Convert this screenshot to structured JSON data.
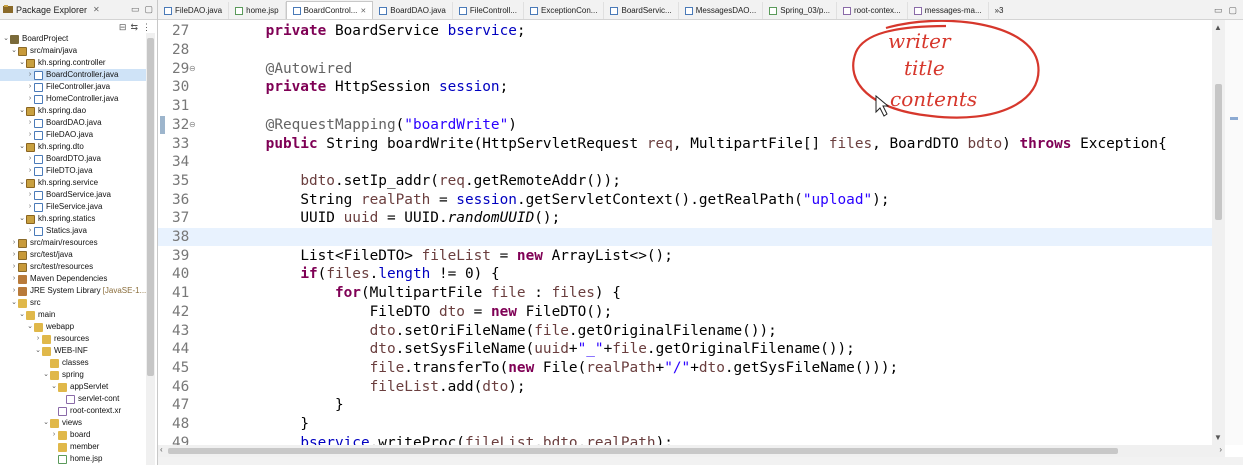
{
  "package_explorer": {
    "title": "Package Explorer",
    "tree": [
      {
        "label": "BoardProject",
        "depth": 0,
        "icon": "project-icon",
        "tw": "v"
      },
      {
        "label": "src/main/java",
        "depth": 1,
        "icon": "source-folder-icon",
        "tw": "v"
      },
      {
        "label": "kh.spring.controller",
        "depth": 2,
        "icon": "package-icon",
        "tw": "v"
      },
      {
        "label": "BoardController.java",
        "depth": 3,
        "icon": "java-file-icon",
        "tw": ">",
        "selected": true
      },
      {
        "label": "FileController.java",
        "depth": 3,
        "icon": "java-file-icon",
        "tw": ">"
      },
      {
        "label": "HomeController.java",
        "depth": 3,
        "icon": "java-file-icon",
        "tw": ">"
      },
      {
        "label": "kh.spring.dao",
        "depth": 2,
        "icon": "package-icon",
        "tw": "v"
      },
      {
        "label": "BoardDAO.java",
        "depth": 3,
        "icon": "java-file-icon",
        "tw": ">"
      },
      {
        "label": "FileDAO.java",
        "depth": 3,
        "icon": "java-file-icon",
        "tw": ">"
      },
      {
        "label": "kh.spring.dto",
        "depth": 2,
        "icon": "package-icon",
        "tw": "v"
      },
      {
        "label": "BoardDTO.java",
        "depth": 3,
        "icon": "java-file-icon",
        "tw": ">"
      },
      {
        "label": "FileDTO.java",
        "depth": 3,
        "icon": "java-file-icon",
        "tw": ">"
      },
      {
        "label": "kh.spring.service",
        "depth": 2,
        "icon": "package-icon",
        "tw": "v"
      },
      {
        "label": "BoardService.java",
        "depth": 3,
        "icon": "java-file-icon",
        "tw": ">"
      },
      {
        "label": "FileService.java",
        "depth": 3,
        "icon": "java-file-icon",
        "tw": ">"
      },
      {
        "label": "kh.spring.statics",
        "depth": 2,
        "icon": "package-icon",
        "tw": "v"
      },
      {
        "label": "Statics.java",
        "depth": 3,
        "icon": "java-file-icon",
        "tw": ">"
      },
      {
        "label": "src/main/resources",
        "depth": 1,
        "icon": "source-folder-icon",
        "tw": ">"
      },
      {
        "label": "src/test/java",
        "depth": 1,
        "icon": "source-folder-icon",
        "tw": ">"
      },
      {
        "label": "src/test/resources",
        "depth": 1,
        "icon": "source-folder-icon",
        "tw": ">"
      },
      {
        "label": "Maven Dependencies",
        "depth": 1,
        "icon": "library-icon",
        "tw": ">"
      },
      {
        "label": "JRE System Library",
        "depth": 1,
        "icon": "library-icon",
        "tw": ">",
        "extra": "[JavaSE-1..."
      },
      {
        "label": "src",
        "depth": 1,
        "icon": "folder-icon",
        "tw": "v"
      },
      {
        "label": "main",
        "depth": 2,
        "icon": "folder-icon",
        "tw": "v"
      },
      {
        "label": "webapp",
        "depth": 3,
        "icon": "folder-icon",
        "tw": "v"
      },
      {
        "label": "resources",
        "depth": 4,
        "icon": "folder-icon",
        "tw": ">"
      },
      {
        "label": "WEB-INF",
        "depth": 4,
        "icon": "folder-icon",
        "tw": "v"
      },
      {
        "label": "classes",
        "depth": 5,
        "icon": "folder-icon",
        "tw": ""
      },
      {
        "label": "spring",
        "depth": 5,
        "icon": "folder-icon",
        "tw": "v"
      },
      {
        "label": "appServlet",
        "depth": 6,
        "icon": "folder-icon",
        "tw": "v"
      },
      {
        "label": "servlet-cont",
        "depth": 7,
        "icon": "xml-file-icon",
        "tw": ""
      },
      {
        "label": "root-context.xr",
        "depth": 6,
        "icon": "xml-file-icon",
        "tw": ""
      },
      {
        "label": "views",
        "depth": 5,
        "icon": "folder-icon",
        "tw": "v"
      },
      {
        "label": "board",
        "depth": 6,
        "icon": "folder-icon",
        "tw": ">"
      },
      {
        "label": "member",
        "depth": 6,
        "icon": "folder-icon",
        "tw": ""
      },
      {
        "label": "home.jsp",
        "depth": 6,
        "icon": "jsp-file-icon",
        "tw": ""
      }
    ]
  },
  "editor_tabs": [
    {
      "label": "FileDAO.java",
      "icon": "java-file-icon"
    },
    {
      "label": "home.jsp",
      "icon": "jsp-file-icon"
    },
    {
      "label": "BoardControl...",
      "icon": "java-file-icon",
      "active": true
    },
    {
      "label": "BoardDAO.java",
      "icon": "java-file-icon"
    },
    {
      "label": "FileControll...",
      "icon": "java-file-icon"
    },
    {
      "label": "ExceptionCon...",
      "icon": "java-file-icon"
    },
    {
      "label": "BoardServic...",
      "icon": "java-file-icon"
    },
    {
      "label": "MessagesDAO...",
      "icon": "java-file-icon"
    },
    {
      "label": "Spring_03/p...",
      "icon": "jsp-file-icon"
    },
    {
      "label": "root-contex...",
      "icon": "xml-file-icon"
    },
    {
      "label": "messages-ma...",
      "icon": "xml-file-icon"
    }
  ],
  "editor_tabs_overflow": "»3",
  "code_lines": [
    {
      "n": "27",
      "code": [
        [
          "    ",
          ""
        ],
        [
          "private",
          "kw"
        ],
        [
          " BoardService ",
          ""
        ],
        [
          "bservice",
          "fd"
        ],
        [
          ";",
          ""
        ]
      ]
    },
    {
      "n": "28",
      "code": []
    },
    {
      "n": "29",
      "fold": "⊖",
      "code": [
        [
          "    ",
          ""
        ],
        [
          "@Autowired",
          "an"
        ]
      ]
    },
    {
      "n": "30",
      "code": [
        [
          "    ",
          ""
        ],
        [
          "private",
          "kw"
        ],
        [
          " HttpSession ",
          ""
        ],
        [
          "session",
          "fd"
        ],
        [
          ";",
          ""
        ]
      ]
    },
    {
      "n": "31",
      "code": []
    },
    {
      "n": "32",
      "fold": "⊖",
      "mark": true,
      "code": [
        [
          "    ",
          ""
        ],
        [
          "@RequestMapping",
          "an"
        ],
        [
          "(",
          ""
        ],
        [
          "\"boardWrite\"",
          "st"
        ],
        [
          ")",
          ""
        ]
      ]
    },
    {
      "n": "33",
      "code": [
        [
          "    ",
          ""
        ],
        [
          "public",
          "kw"
        ],
        [
          " String boardWrite(HttpServletRequest ",
          ""
        ],
        [
          "req",
          "lv"
        ],
        [
          ", MultipartFile[] ",
          ""
        ],
        [
          "files",
          "lv"
        ],
        [
          ", BoardDTO ",
          ""
        ],
        [
          "bdto",
          "lv"
        ],
        [
          ") ",
          ""
        ],
        [
          "throws",
          "kw"
        ],
        [
          " Exception{",
          ""
        ]
      ]
    },
    {
      "n": "34",
      "code": []
    },
    {
      "n": "35",
      "code": [
        [
          "        ",
          ""
        ],
        [
          "bdto",
          "lv"
        ],
        [
          ".setIp_addr(",
          ""
        ],
        [
          "req",
          "lv"
        ],
        [
          ".getRemoteAddr());",
          ""
        ]
      ]
    },
    {
      "n": "36",
      "code": [
        [
          "        ",
          ""
        ],
        [
          "String ",
          ""
        ],
        [
          "realPath",
          "lv"
        ],
        [
          " = ",
          ""
        ],
        [
          "session",
          "fd"
        ],
        [
          ".getServletContext().getRealPath(",
          ""
        ],
        [
          "\"upload\"",
          "st"
        ],
        [
          ");",
          ""
        ]
      ]
    },
    {
      "n": "37",
      "code": [
        [
          "        ",
          ""
        ],
        [
          "UUID ",
          ""
        ],
        [
          "uuid",
          "lv"
        ],
        [
          " = UUID.",
          ""
        ],
        [
          "randomUUID",
          "it"
        ],
        [
          "();",
          ""
        ]
      ]
    },
    {
      "n": "38",
      "current": true,
      "code": []
    },
    {
      "n": "39",
      "code": [
        [
          "        ",
          ""
        ],
        [
          "List<FileDTO> ",
          ""
        ],
        [
          "fileList",
          "lv"
        ],
        [
          " = ",
          ""
        ],
        [
          "new",
          "kw"
        ],
        [
          " ArrayList<>();",
          ""
        ]
      ]
    },
    {
      "n": "40",
      "code": [
        [
          "        ",
          ""
        ],
        [
          "if",
          "kw"
        ],
        [
          "(",
          ""
        ],
        [
          "files",
          "lv"
        ],
        [
          ".",
          ""
        ],
        [
          "length",
          "fd"
        ],
        [
          " != 0) {",
          ""
        ]
      ]
    },
    {
      "n": "41",
      "code": [
        [
          "            ",
          ""
        ],
        [
          "for",
          "kw"
        ],
        [
          "(MultipartFile ",
          ""
        ],
        [
          "file",
          "lv"
        ],
        [
          " : ",
          ""
        ],
        [
          "files",
          "lv"
        ],
        [
          ") {",
          ""
        ]
      ]
    },
    {
      "n": "42",
      "code": [
        [
          "                ",
          ""
        ],
        [
          "FileDTO ",
          ""
        ],
        [
          "dto",
          "lv"
        ],
        [
          " = ",
          ""
        ],
        [
          "new",
          "kw"
        ],
        [
          " FileDTO();",
          ""
        ]
      ]
    },
    {
      "n": "43",
      "code": [
        [
          "                ",
          ""
        ],
        [
          "dto",
          "lv"
        ],
        [
          ".setOriFileName(",
          ""
        ],
        [
          "file",
          "lv"
        ],
        [
          ".getOriginalFilename());",
          ""
        ]
      ]
    },
    {
      "n": "44",
      "code": [
        [
          "                ",
          ""
        ],
        [
          "dto",
          "lv"
        ],
        [
          ".setSysFileName(",
          ""
        ],
        [
          "uuid",
          "lv"
        ],
        [
          "+",
          ""
        ],
        [
          "\"_\"",
          "st"
        ],
        [
          "+",
          ""
        ],
        [
          "file",
          "lv"
        ],
        [
          ".getOriginalFilename());",
          ""
        ]
      ]
    },
    {
      "n": "45",
      "code": [
        [
          "                ",
          ""
        ],
        [
          "file",
          "lv"
        ],
        [
          ".transferTo(",
          ""
        ],
        [
          "new",
          "kw"
        ],
        [
          " File(",
          ""
        ],
        [
          "realPath",
          "lv"
        ],
        [
          "+",
          ""
        ],
        [
          "\"/\"",
          "st"
        ],
        [
          "+",
          ""
        ],
        [
          "dto",
          "lv"
        ],
        [
          ".getSysFileName()));",
          ""
        ]
      ]
    },
    {
      "n": "46",
      "code": [
        [
          "                ",
          ""
        ],
        [
          "fileList",
          "lv"
        ],
        [
          ".add(",
          ""
        ],
        [
          "dto",
          "lv"
        ],
        [
          ");",
          ""
        ]
      ]
    },
    {
      "n": "47",
      "code": [
        [
          "            ",
          ""
        ],
        [
          "}",
          ""
        ]
      ]
    },
    {
      "n": "48",
      "code": [
        [
          "        ",
          ""
        ],
        [
          "}",
          ""
        ]
      ]
    },
    {
      "n": "49",
      "code": [
        [
          "        ",
          ""
        ],
        [
          "bservice",
          "fd"
        ],
        [
          ".writeProc(",
          ""
        ],
        [
          "fileList",
          "lv"
        ],
        [
          ",",
          ""
        ],
        [
          "bdto",
          "lv"
        ],
        [
          ",",
          ""
        ],
        [
          "realPath",
          "lv"
        ],
        [
          ");",
          ""
        ]
      ]
    }
  ],
  "annotation": {
    "lines": [
      "writer",
      "title",
      "contents"
    ],
    "color": "#d6372c"
  },
  "colors": {
    "keyword": "#7f0055",
    "string": "#2a00ff",
    "field": "#0000c0",
    "local": "#6a3e3e",
    "annotation": "#646464",
    "line_number": "#787878",
    "current_line": "#e8f2fe",
    "selection": "#cfe3f7"
  }
}
